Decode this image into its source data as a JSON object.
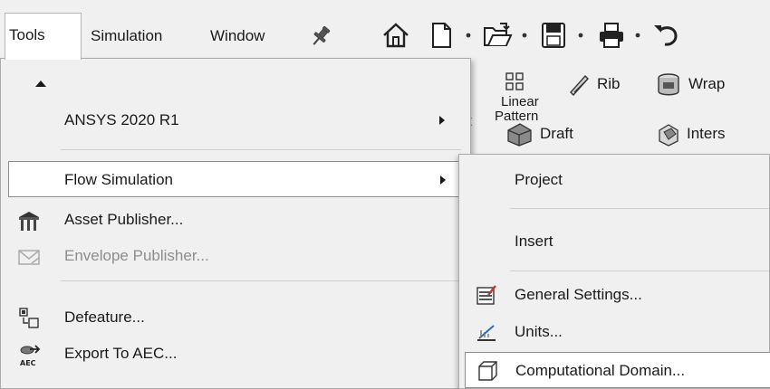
{
  "menubar": {
    "items": [
      {
        "label": "Tools"
      },
      {
        "label": "Simulation"
      },
      {
        "label": "Window"
      }
    ],
    "pin_icon": "pushpin-icon"
  },
  "quick_access": {
    "icons": [
      "home-icon",
      "new-document-icon",
      "open-folder-icon",
      "save-icon",
      "print-icon",
      "undo-icon"
    ]
  },
  "ribbon": {
    "partial_label": "t",
    "linear_pattern_line1": "Linear",
    "linear_pattern_line2": "Pattern",
    "rib": "Rib",
    "draft": "Draft",
    "wrap": "Wrap",
    "intersect": "Inters"
  },
  "tools_menu": {
    "items": [
      {
        "label": "ANSYS 2020 R1",
        "submenu": true
      },
      {
        "label": "Flow Simulation",
        "submenu": true,
        "highlighted": true
      },
      {
        "label": "Asset Publisher...",
        "icon": "asset-publisher-icon"
      },
      {
        "label": "Envelope Publisher...",
        "icon": "envelope-publisher-icon",
        "disabled": true
      },
      {
        "label": "Defeature...",
        "icon": "defeature-icon"
      },
      {
        "label": "Export To AEC...",
        "icon": "export-aec-icon",
        "icon_text": "AEC"
      }
    ]
  },
  "flow_submenu": {
    "items": [
      {
        "label": "Project"
      },
      {
        "label": "Insert"
      },
      {
        "label": "General Settings...",
        "icon": "general-settings-icon"
      },
      {
        "label": "Units...",
        "icon": "units-icon"
      },
      {
        "label": "Computational Domain...",
        "icon": "computational-domain-icon",
        "highlighted": true
      }
    ]
  },
  "colors": {
    "menu_background": "#f0f0f0",
    "highlight_background": "#ffffff",
    "highlight_border": "#8e8e8e",
    "disabled_text": "#8d8d8d",
    "accent_red": "#c0392b",
    "accent_blue": "#2a6fb0"
  }
}
